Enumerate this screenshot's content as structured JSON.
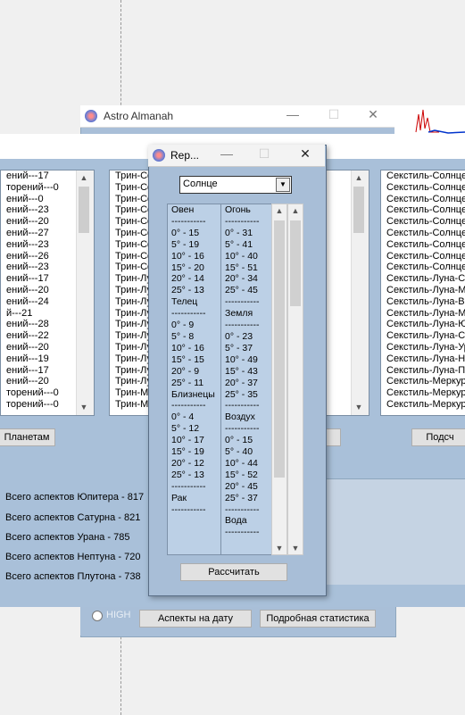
{
  "back_window": {
    "title": "Astro Almanah"
  },
  "left_list": [
    "ений---17",
    "торений---0",
    "ений---0",
    "ений---23",
    "ений---20",
    "ений---27",
    "ений---23",
    "ений---26",
    "ений---23",
    "ений---17",
    "ений---20",
    "ений---24",
    "й---21",
    "ений---28",
    "ений---22",
    "ений---20",
    "ений---19",
    "ений---17",
    "ений---20",
    "торений---0",
    "торений---0"
  ],
  "trin_list": [
    "Трин-Со",
    "Трин-Со",
    "Трин-Со",
    "Трин-Со",
    "Трин-Со",
    "Трин-Со",
    "Трин-Со",
    "Трин-Со",
    "Трин-Со",
    "Трин-Лу",
    "Трин-Лу",
    "Трин-Лу",
    "Трин-Лу",
    "Трин-Лу",
    "Трин-Лу",
    "Трин-Лу",
    "Трин-Лу",
    "Трин-Лу",
    "Трин-Лу",
    "Трин-Ме",
    "Трин-Ме"
  ],
  "sextile_list": [
    "Секстиль-Солнце-",
    "Секстиль-Солнце-",
    "Секстиль-Солнце-",
    "Секстиль-Солнце-",
    "Секстиль-Солнце-",
    "Секстиль-Солнце-",
    "Секстиль-Солнце-",
    "Секстиль-Солнце-",
    "Секстиль-Солнце-",
    "Секстиль-Луна-Со",
    "Секстиль-Луна-Ме",
    "Секстиль-Луна-Ве",
    "Секстиль-Луна-Ма",
    "Секстиль-Луна-Юп",
    "Секстиль-Луна-Са",
    "Секстиль-Луна-Ур",
    "Секстиль-Луна-Не",
    "Секстиль-Луна-Пл",
    "Секстиль-Меркур",
    "Секстиль-Меркур",
    "Секстиль-Меркур"
  ],
  "buttons": {
    "planets": "Планетам",
    "count": "Подсч",
    "calc": "Рассчитать",
    "aspects_date": "Аспекты на дату",
    "detailed_stats": "Подробная статистика"
  },
  "radio_label": "HIGH",
  "stats": [
    "Всего аспектов Юпитера - 817",
    "Всего аспектов Сатурна - 821",
    "Всего аспектов Урана - 785",
    "Всего аспектов Нептуна - 720",
    "Всего аспектов Плутона - 738"
  ],
  "popup": {
    "title": "Rep...",
    "select_value": "Солнце",
    "col1": [
      "Овен",
      "-----------",
      "0° - 15",
      "5° - 19",
      "10° - 16",
      "15° - 20",
      "20° - 14",
      "25° - 13",
      "",
      "Телец",
      "-----------",
      "0° - 9",
      "5° - 8",
      "10° - 16",
      "15° - 15",
      "20° - 9",
      "25° - 11",
      "",
      "Близнецы",
      "-----------",
      "0° - 4",
      "5° - 12",
      "10° - 17",
      "15° - 19",
      "20° - 12",
      "25° - 13",
      "-----------",
      "Рак",
      "-----------"
    ],
    "col2": [
      "Огонь",
      "-----------",
      "0° - 31",
      "5° - 41",
      "10° - 40",
      "15° - 51",
      "20° - 34",
      "25° - 45",
      "-----------",
      "Земля",
      "-----------",
      "0° - 23",
      "5° - 37",
      "10° - 49",
      "15° - 43",
      "20° - 37",
      "25° - 35",
      "-----------",
      "Воздух",
      "-----------",
      "0° - 15",
      "5° - 40",
      "10° - 44",
      "15° - 52",
      "20° - 45",
      "25° - 37",
      "-----------",
      "Вода",
      "-----------"
    ]
  }
}
